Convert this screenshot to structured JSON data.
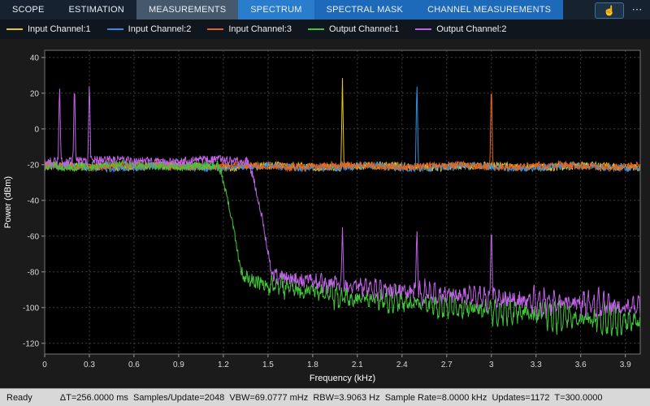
{
  "toolbar": {
    "tabs": [
      {
        "label": "SCOPE",
        "state": "normal"
      },
      {
        "label": "ESTIMATION",
        "state": "normal"
      },
      {
        "label": "MEASUREMENTS",
        "state": "selected"
      },
      {
        "label": "SPECTRUM",
        "state": "context-active"
      },
      {
        "label": "SPECTRAL MASK",
        "state": "context"
      },
      {
        "label": "CHANNEL MEASUREMENTS",
        "state": "context"
      }
    ],
    "pointer_icon": "☝",
    "more_label": "⋯"
  },
  "chart_data": {
    "type": "line",
    "title": "",
    "xlabel": "Frequency (kHz)",
    "ylabel": "Power (dBm)",
    "xlim": [
      0,
      4
    ],
    "ylim": [
      -126,
      44
    ],
    "grid": true,
    "legend_position": "top",
    "xticks": [
      0,
      0.3,
      0.6,
      0.9,
      1.2,
      1.5,
      1.8,
      2.1,
      2.4,
      2.7,
      3,
      3.3,
      3.6,
      3.9
    ],
    "xtick_labels": [
      "0",
      "0.3",
      "0.6",
      "0.9",
      "1.2",
      "1.5",
      "1.8",
      "2.1",
      "2.4",
      "2.7",
      "3",
      "3.3",
      "3.6",
      "3.9"
    ],
    "yticks": [
      40,
      20,
      0,
      -20,
      -40,
      -60,
      -80,
      -100,
      -120
    ],
    "ytick_labels": [
      "40",
      "20",
      "0",
      "-20",
      "-40",
      "-60",
      "-80",
      "-100",
      "-120"
    ],
    "colors": {
      "accent_blue": "#2a7ccc",
      "plot_background": "#000000",
      "grid_line": "#3d3d3d"
    },
    "series": [
      {
        "name": "Input Channel:1",
        "color": "#e8c619",
        "kind": "flat",
        "floor": -21,
        "jitter": 2.2,
        "spikes": [
          {
            "x": 2.0,
            "y": 28.5
          }
        ]
      },
      {
        "name": "Input Channel:2",
        "color": "#2f8fe8",
        "kind": "flat",
        "floor": -21.3,
        "jitter": 2.2,
        "spikes": [
          {
            "x": 2.5,
            "y": 28
          }
        ]
      },
      {
        "name": "Input Channel:3",
        "color": "#e8641c",
        "kind": "flat",
        "floor": -20.8,
        "jitter": 2.2,
        "spikes": [
          {
            "x": 3.0,
            "y": 28
          }
        ]
      },
      {
        "name": "Output Channel:1",
        "color": "#41c63a",
        "kind": "lowpass",
        "pass_floor": -20.5,
        "jitter": 2.6,
        "cutoff_start": 1.16,
        "cutoff_end": 1.32,
        "stop_start": -82,
        "stop_end": -108,
        "ripple_amp": 9,
        "spikes": []
      },
      {
        "name": "Output Channel:2",
        "color": "#bf62e3",
        "kind": "lowpass",
        "pass_floor": -18,
        "jitter": 2.6,
        "cutoff_start": 1.36,
        "cutoff_end": 1.52,
        "stop_start": -80,
        "stop_end": -100,
        "ripple_amp": 7,
        "spikes": [
          {
            "x": 0.1,
            "y": 26.5
          },
          {
            "x": 0.2,
            "y": 27.5
          },
          {
            "x": 0.3,
            "y": 28
          },
          {
            "x": 2.0,
            "y": -55
          },
          {
            "x": 2.5,
            "y": -54
          },
          {
            "x": 3.0,
            "y": -52
          }
        ]
      }
    ]
  },
  "status_bar": {
    "ready": "Ready",
    "info": "ΔT=256.0000 ms  Samples/Update=2048  VBW=69.0777 mHz  RBW=3.9063 Hz  Sample Rate=8.0000 kHz  Updates=1172  T=300.0000"
  }
}
